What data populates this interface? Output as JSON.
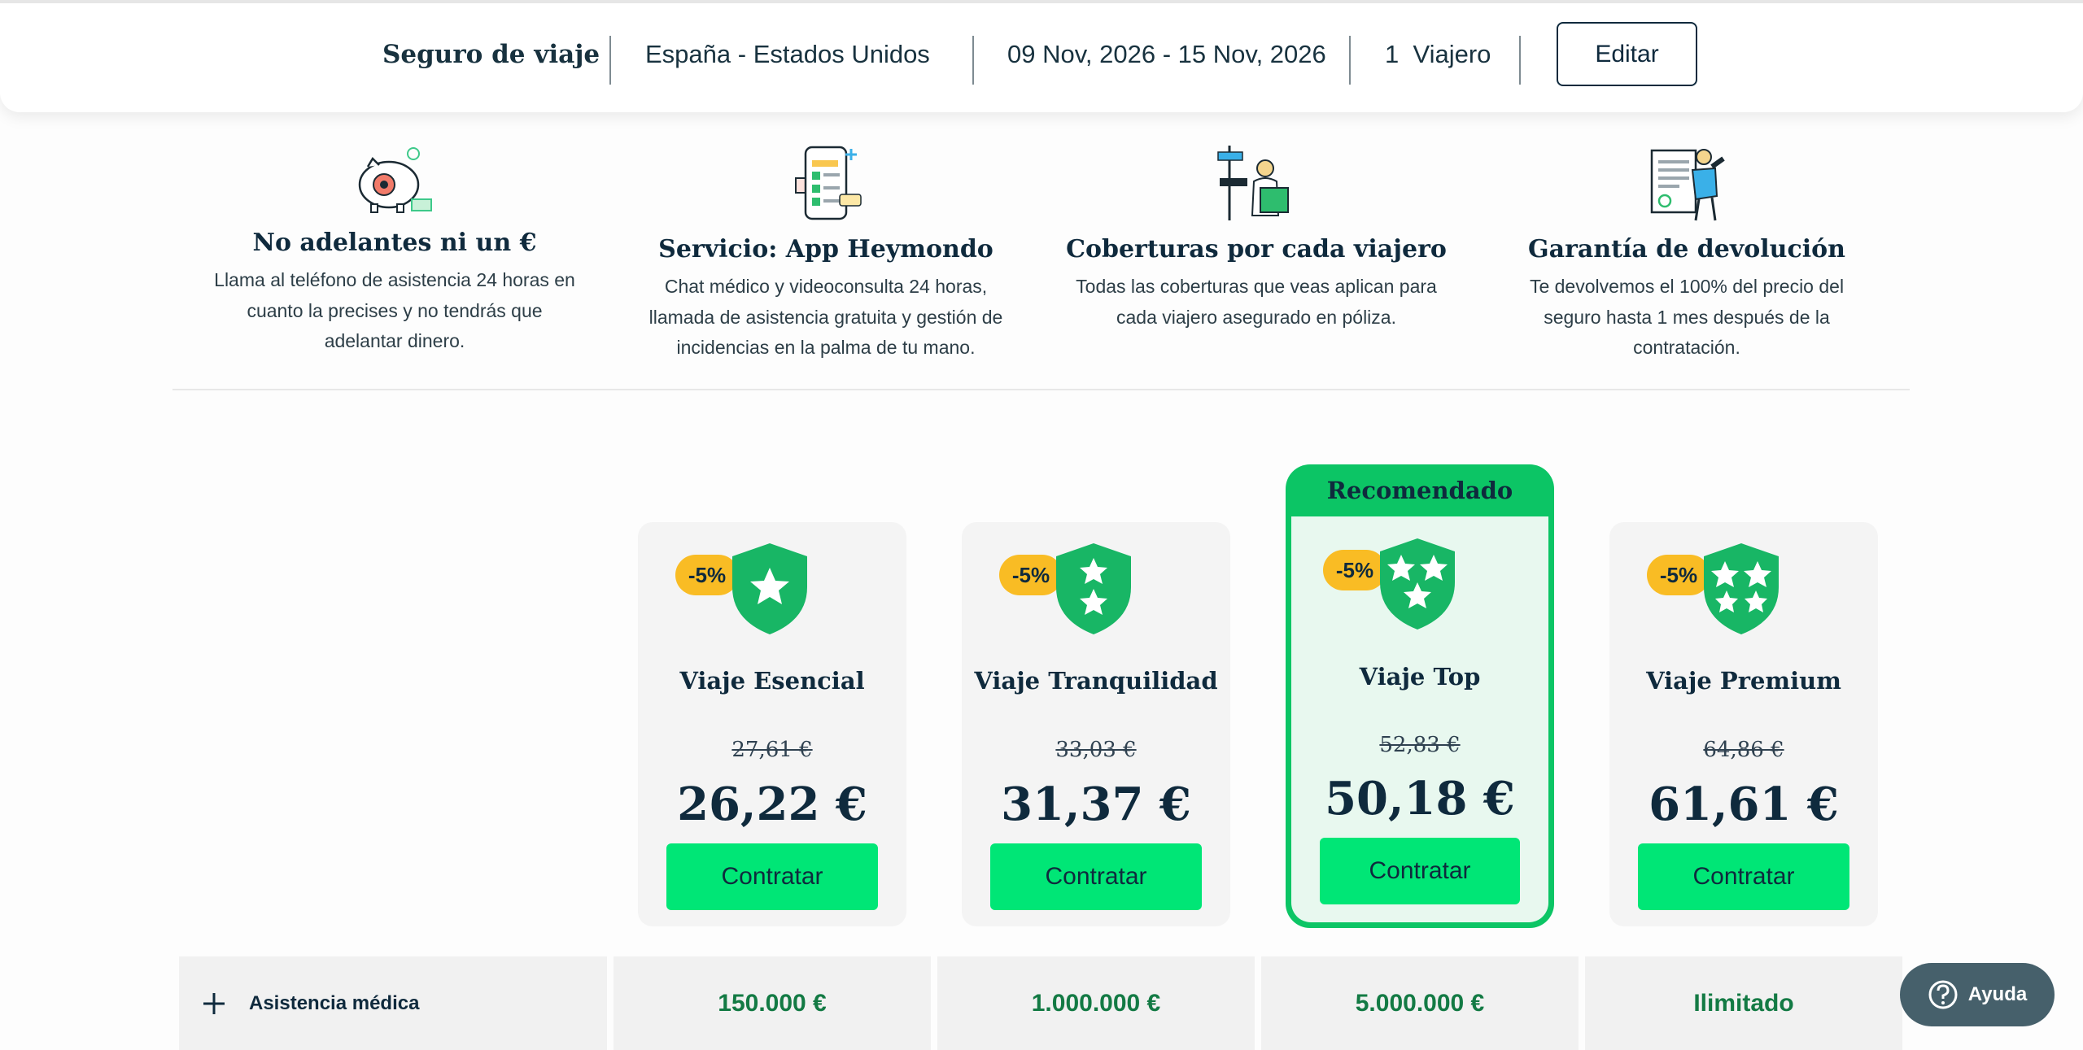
{
  "header": {
    "product": "Seguro de viaje",
    "route": "España - Estados Unidos",
    "dates": "09 Nov, 2026 - 15 Nov, 2026",
    "travelers": "1  Viajero",
    "edit_label": "Editar"
  },
  "features": [
    {
      "icon": "piggy-bank-icon",
      "title": "No adelantes ni un €",
      "lines": [
        "Llama al teléfono de asistencia 24 horas en",
        "cuanto la precises y no tendrás que",
        "adelantar dinero."
      ]
    },
    {
      "icon": "phone-app-icon",
      "title": "Servicio: App Heymondo",
      "lines": [
        "Chat médico y videoconsulta 24 horas,",
        "llamada de asistencia gratuita y gestión de",
        "incidencias en la palma de tu mano."
      ]
    },
    {
      "icon": "traveler-signpost-icon",
      "title": "Coberturas por cada viajero",
      "lines": [
        "Todas las coberturas que veas aplican para",
        "cada viajero asegurado en póliza."
      ]
    },
    {
      "icon": "refund-guarantee-icon",
      "title": "Garantía de devolución",
      "lines": [
        "Te devolvemos el 100% del precio del",
        "seguro hasta 1 mes después de la",
        "contratación."
      ]
    }
  ],
  "recommended_label": "Recomendado",
  "plans": [
    {
      "name": "Viaje Esencial",
      "discount": "-5%",
      "stars": 1,
      "old_price": "27,61 €",
      "price": "26,22 €",
      "cta": "Contratar",
      "recommended": false
    },
    {
      "name": "Viaje Tranquilidad",
      "discount": "-5%",
      "stars": 2,
      "old_price": "33,03 €",
      "price": "31,37 €",
      "cta": "Contratar",
      "recommended": false
    },
    {
      "name": "Viaje Top",
      "discount": "-5%",
      "stars": 3,
      "old_price": "52,83 €",
      "price": "50,18 €",
      "cta": "Contratar",
      "recommended": true
    },
    {
      "name": "Viaje Premium",
      "discount": "-5%",
      "stars": 4,
      "old_price": "64,86 €",
      "price": "61,61 €",
      "cta": "Contratar",
      "recommended": false
    }
  ],
  "coverage": {
    "label": "Asistencia médica",
    "values": [
      "150.000 €",
      "1.000.000 €",
      "5.000.000 €",
      "Ilimitado"
    ]
  },
  "help_label": "Ayuda",
  "colors": {
    "brand_green": "#00e676",
    "dark_green": "#0cc565",
    "badge_yellow": "#f9bc24",
    "navy": "#0f2a3d"
  }
}
